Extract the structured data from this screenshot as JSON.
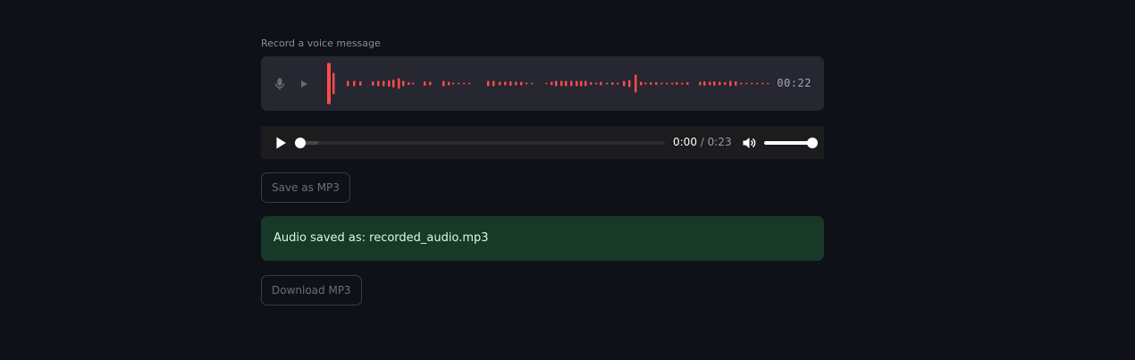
{
  "recorder": {
    "label": "Record a voice message",
    "timer": "00:22",
    "accent_color": "#ff4b4b",
    "icons": [
      "mic-icon",
      "play-icon"
    ]
  },
  "player": {
    "current_time": "0:00",
    "separator": " / ",
    "duration": "0:23",
    "progress": 0,
    "buffered": 0.05,
    "volume": 1.0,
    "icons": [
      "play-icon",
      "volume-icon"
    ]
  },
  "buttons": {
    "save": "Save as MP3",
    "download": "Download MP3"
  },
  "alert": {
    "message": "Audio saved as: recorded_audio.mp3",
    "color": "#173928"
  }
}
